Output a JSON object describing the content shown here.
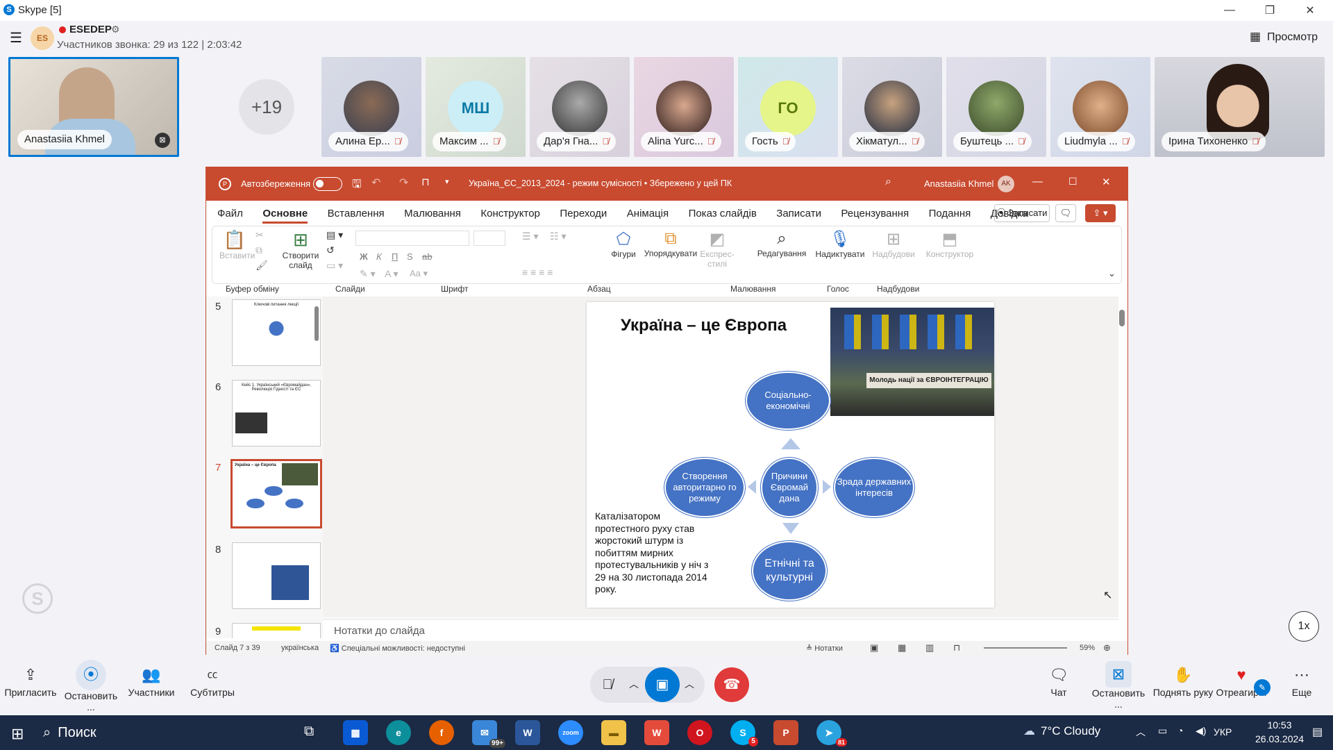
{
  "window": {
    "title": "Skype [5]"
  },
  "call": {
    "group_name": "ESEDEP",
    "participants_info": "Участников звонка: 29 из 122 | 2:03:42",
    "view_label": "Просмотр",
    "overflow_count": "+19",
    "self_initials": "ES"
  },
  "participants": [
    {
      "name": "Anastasiia Khmel"
    },
    {
      "name": "Алина Ер..."
    },
    {
      "name": "Максим ...",
      "initials": "МШ"
    },
    {
      "name": "Дар'я Гна..."
    },
    {
      "name": "Alina Yurc..."
    },
    {
      "name": "Гость",
      "initials": "ГО"
    },
    {
      "name": "Хікматул..."
    },
    {
      "name": "Буштець ..."
    },
    {
      "name": "Liudmyla ..."
    },
    {
      "name": "Ірина Тихоненко"
    }
  ],
  "ppt": {
    "autosave": "Автозбереження",
    "doc_title": "Україна_ЄС_2013_2024  -  режим сумісності  •  Збережено у цей ПК",
    "user": "Anastasiia Khmel",
    "user_initials": "AK",
    "tabs": [
      "Файл",
      "Основне",
      "Вставлення",
      "Малювання",
      "Конструктор",
      "Переходи",
      "Анімація",
      "Показ слайдів",
      "Записати",
      "Рецензування",
      "Подання",
      "Довідка"
    ],
    "record_btn": "Записати",
    "ribbon": {
      "paste": "Вставити",
      "new_slide": "Створити слайд",
      "shapes": "Фігури",
      "arrange": "Упорядкувати",
      "express": "Експрес-стилі",
      "editing": "Редагування",
      "dictate": "Надиктувати",
      "addins": "Надбудови",
      "designer": "Конструктор",
      "groups": [
        "Буфер обміну",
        "Слайди",
        "Шрифт",
        "Абзац",
        "Малювання",
        "Голос",
        "Надбудови"
      ],
      "font_btns": [
        "Ж",
        "К",
        "П",
        "S",
        "ab"
      ]
    },
    "thumbs": [
      {
        "num": "5",
        "title": "Ключові питання лекції"
      },
      {
        "num": "6",
        "title": "Кейс 1. Український «Євромайдан», Революція Гідності та ЄС"
      },
      {
        "num": "7",
        "title": "Україна – це Європа"
      },
      {
        "num": "8",
        "title": ""
      },
      {
        "num": "9",
        "title": ""
      }
    ],
    "slide": {
      "title": "Україна – це Європа",
      "photo_banner": "Молодь нації за ЄВРОІНТЕГРАЦІЮ",
      "center": "Причини Євромай дана",
      "top": "Соціально-економічні",
      "left": "Створення авторитарно го режиму",
      "right": "Зрада державних інтересів",
      "bottom": "Етнічні та культурні",
      "text": "Каталізатором протестного руху став жорстокий штурм із побиттям мирних протестувальників у ніч з 29 на 30 листопада 2014 року."
    },
    "notes_placeholder": "Нотатки до слайда",
    "status": {
      "slide": "Слайд 7 з 39",
      "lang": "українська",
      "access": "Спеціальні можливості: недоступні",
      "notes": "Нотатки",
      "zoom": "59%"
    }
  },
  "speed": "1x",
  "toolbar": {
    "invite": "Пригласить",
    "stop_share": "Остановить ...",
    "participants": "Участники",
    "subtitles": "Субтитры",
    "chat": "Чат",
    "stop2": "Остановить ...",
    "raise_hand": "Поднять руку",
    "react": "Отреагир...",
    "more": "Еще"
  },
  "taskbar": {
    "search": "Поиск",
    "weather": "7°C  Cloudy",
    "lang": "УКР",
    "time": "10:53",
    "date": "26.03.2024",
    "mail_badge": "99+",
    "skype_badge": "5",
    "telegram_badge": "81"
  }
}
